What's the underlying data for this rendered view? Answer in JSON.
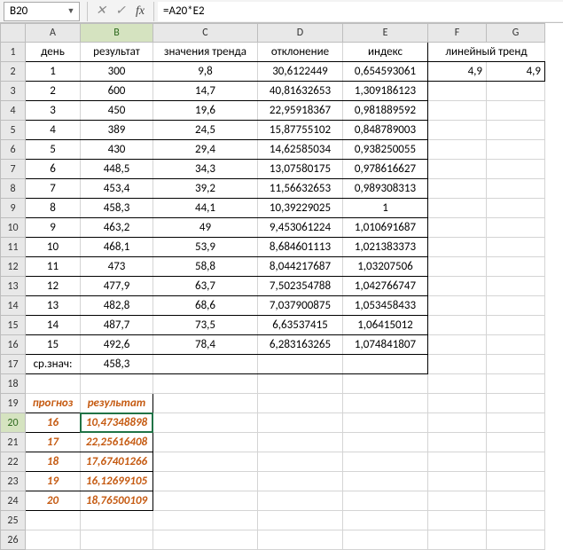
{
  "formula_bar": {
    "name_box": "B20",
    "cancel_glyph": "✕",
    "confirm_glyph": "✓",
    "fx_label": "fx",
    "formula": "=A20*E2"
  },
  "col_headers": [
    "A",
    "B",
    "C",
    "D",
    "E",
    "F",
    "G"
  ],
  "row_headers": [
    "1",
    "2",
    "3",
    "4",
    "5",
    "6",
    "7",
    "8",
    "9",
    "10",
    "11",
    "12",
    "13",
    "14",
    "15",
    "16",
    "17",
    "18",
    "19",
    "20",
    "21",
    "22",
    "23",
    "24",
    "25",
    "26"
  ],
  "headers": {
    "A": "день",
    "B": "результат",
    "C": "значения тренда",
    "D": "отклонение",
    "E": "индекс",
    "FG": "линейный тренд"
  },
  "rows": [
    {
      "A": "1",
      "B": "300",
      "C": "9,8",
      "D": "30,6122449",
      "E": "0,654593061",
      "F": "4,9",
      "G": "4,9"
    },
    {
      "A": "2",
      "B": "600",
      "C": "14,7",
      "D": "40,81632653",
      "E": "1,309186123"
    },
    {
      "A": "3",
      "B": "450",
      "C": "19,6",
      "D": "22,95918367",
      "E": "0,981889592"
    },
    {
      "A": "4",
      "B": "389",
      "C": "24,5",
      "D": "15,87755102",
      "E": "0,848789003"
    },
    {
      "A": "5",
      "B": "430",
      "C": "29,4",
      "D": "14,62585034",
      "E": "0,938250055"
    },
    {
      "A": "6",
      "B": "448,5",
      "C": "34,3",
      "D": "13,07580175",
      "E": "0,978616627"
    },
    {
      "A": "7",
      "B": "453,4",
      "C": "39,2",
      "D": "11,56632653",
      "E": "0,989308313"
    },
    {
      "A": "8",
      "B": "458,3",
      "C": "44,1",
      "D": "10,39229025",
      "E": "1"
    },
    {
      "A": "9",
      "B": "463,2",
      "C": "49",
      "D": "9,453061224",
      "E": "1,010691687"
    },
    {
      "A": "10",
      "B": "468,1",
      "C": "53,9",
      "D": "8,684601113",
      "E": "1,021383373"
    },
    {
      "A": "11",
      "B": "473",
      "C": "58,8",
      "D": "8,044217687",
      "E": "1,03207506"
    },
    {
      "A": "12",
      "B": "477,9",
      "C": "63,7",
      "D": "7,502354788",
      "E": "1,042766747"
    },
    {
      "A": "13",
      "B": "482,8",
      "C": "68,6",
      "D": "7,037900875",
      "E": "1,053458433"
    },
    {
      "A": "14",
      "B": "487,7",
      "C": "73,5",
      "D": "6,63537415",
      "E": "1,06415012"
    },
    {
      "A": "15",
      "B": "492,6",
      "C": "78,4",
      "D": "6,283163265",
      "E": "1,074841807"
    }
  ],
  "avg_row": {
    "A": "ср.знач:",
    "B": "458,3"
  },
  "forecast_header": {
    "A": "прогноз",
    "B": "результат"
  },
  "forecast": [
    {
      "A": "16",
      "B": "10,47348898"
    },
    {
      "A": "17",
      "B": "22,25616408"
    },
    {
      "A": "18",
      "B": "17,67401266"
    },
    {
      "A": "19",
      "B": "16,12699105"
    },
    {
      "A": "20",
      "B": "18,76500109"
    }
  ],
  "selected_cell": "B20"
}
